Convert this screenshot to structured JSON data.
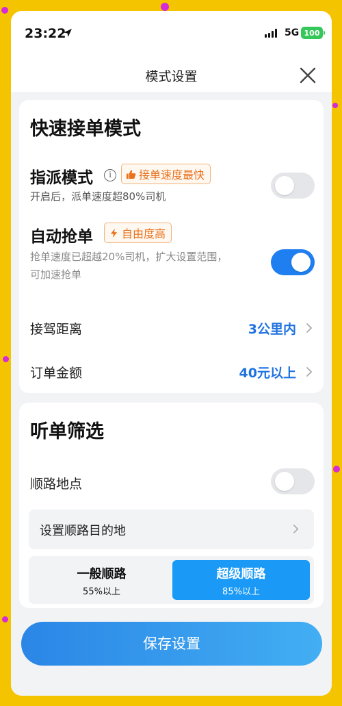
{
  "status_bar": {
    "time": "23:22",
    "network": "5G",
    "battery": "100"
  },
  "header": {
    "title": "模式设置"
  },
  "quick_mode": {
    "section_title": "快速接单模式",
    "dispatch": {
      "title": "指派模式",
      "badge": "接单速度最快",
      "desc": "开启后，派单速度超80%司机",
      "enabled": false
    },
    "auto_grab": {
      "title": "自动抢单",
      "badge": "自由度高",
      "desc_line1": "抢单速度已超越20%司机，扩大设置范围，",
      "desc_line2": "可加速抢单",
      "enabled": true
    },
    "pickup_distance": {
      "label": "接驾距离",
      "value": "3公里内"
    },
    "order_amount": {
      "label": "订单金额",
      "value": "40元以上"
    }
  },
  "filter": {
    "section_title": "听单筛选",
    "en_route": {
      "label": "顺路地点",
      "enabled": false
    },
    "destination": {
      "label": "设置顺路目的地"
    },
    "segment": {
      "normal": {
        "title": "一般顺路",
        "sub": "55%以上"
      },
      "super": {
        "title": "超级顺路",
        "sub": "85%以上"
      },
      "selected": "super"
    }
  },
  "save_button": "保存设置",
  "colors": {
    "accent": "#1f7ef0",
    "badge_orange": "#e8711c",
    "segment_selected": "#1a9af6",
    "background_frame": "#f5c400"
  }
}
